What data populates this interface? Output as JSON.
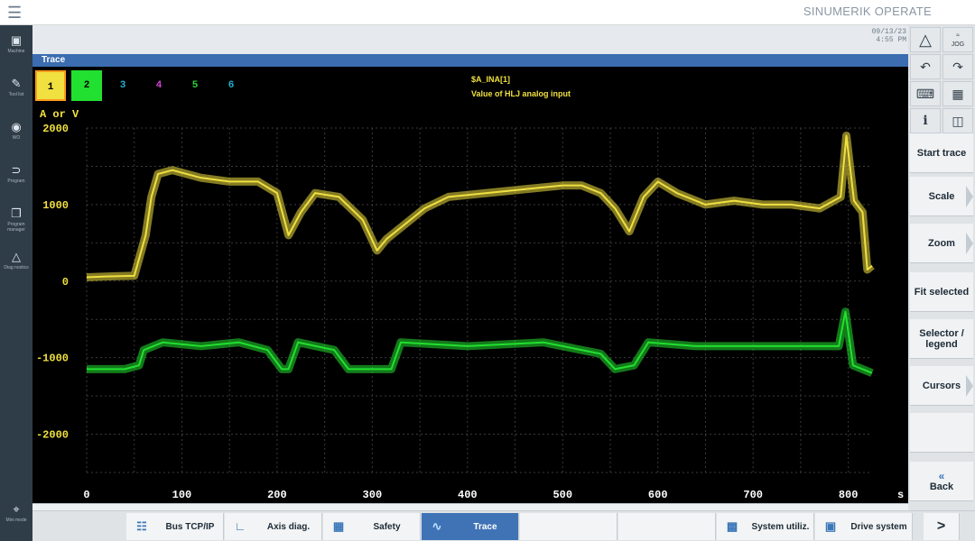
{
  "topbar": {
    "brand": "SINUMERIK OPERATE",
    "menu_icon": "hamburger-icon"
  },
  "leftnav": [
    {
      "label": "Machine",
      "icon": "machine-icon"
    },
    {
      "label": "Tool list",
      "icon": "tool-list-icon"
    },
    {
      "label": "WO",
      "icon": "work-offset-icon"
    },
    {
      "label": "Program",
      "icon": "program-icon"
    },
    {
      "label": "Program manager",
      "icon": "program-manager-icon"
    },
    {
      "label": "Diag nostics",
      "icon": "diagnostics-icon"
    },
    {
      "label": "Mini mode",
      "icon": "minimode-icon"
    }
  ],
  "status": {
    "date": "09/13/23",
    "time": "4:55 PM"
  },
  "window": {
    "title": "Trace"
  },
  "channels": [
    {
      "label": "1",
      "color": "#f0e040",
      "selected": true
    },
    {
      "label": "2",
      "color": "#22e030",
      "selected": true
    },
    {
      "label": "3",
      "color": "#20b0d0",
      "selected": false
    },
    {
      "label": "4",
      "color": "#d040d0",
      "selected": false
    },
    {
      "label": "5",
      "color": "#30d040",
      "selected": false
    },
    {
      "label": "6",
      "color": "#20b0d0",
      "selected": false
    }
  ],
  "signal": {
    "name": "$A_INA[1]",
    "description": "Value of HLJ analog input"
  },
  "chart_data": {
    "type": "line",
    "ylabel": "A or V",
    "xlabel": "s",
    "xlim": [
      0,
      825
    ],
    "ylim": [
      -2500,
      2000
    ],
    "x_ticks": [
      0,
      100,
      200,
      300,
      400,
      500,
      600,
      700,
      800
    ],
    "y_ticks": [
      2000,
      1000,
      0,
      -1000,
      -2000
    ],
    "grid": true,
    "series": [
      {
        "color": "#f0e040",
        "x": [
          0,
          20,
          50,
          62,
          68,
          75,
          90,
          120,
          150,
          180,
          200,
          212,
          225,
          240,
          265,
          290,
          305,
          315,
          330,
          355,
          380,
          420,
          460,
          500,
          520,
          540,
          555,
          570,
          585,
          600,
          620,
          650,
          680,
          710,
          740,
          770,
          792,
          798,
          806,
          815,
          820,
          825
        ],
        "y": [
          50,
          60,
          70,
          600,
          1100,
          1400,
          1450,
          1350,
          1300,
          1300,
          1150,
          600,
          900,
          1150,
          1100,
          800,
          400,
          550,
          700,
          950,
          1100,
          1150,
          1200,
          1250,
          1250,
          1150,
          950,
          650,
          1100,
          1300,
          1150,
          1000,
          1050,
          1000,
          1000,
          950,
          1100,
          1900,
          1050,
          900,
          150,
          200
        ]
      },
      {
        "color": "#22e030",
        "x": [
          0,
          40,
          55,
          60,
          80,
          120,
          160,
          190,
          205,
          212,
          222,
          260,
          275,
          300,
          315,
          320,
          330,
          400,
          480,
          540,
          555,
          575,
          590,
          640,
          700,
          760,
          790,
          797,
          805,
          815,
          825
        ],
        "y": [
          -1150,
          -1150,
          -1100,
          -900,
          -800,
          -850,
          -800,
          -900,
          -1150,
          -1150,
          -800,
          -900,
          -1150,
          -1150,
          -1150,
          -1150,
          -800,
          -850,
          -800,
          -950,
          -1150,
          -1100,
          -800,
          -850,
          -850,
          -850,
          -850,
          -400,
          -1100,
          -1150,
          -1200
        ]
      }
    ]
  },
  "softkeys": [
    {
      "label": "Start trace",
      "arrow": false
    },
    {
      "label": "Scale",
      "arrow": true
    },
    {
      "label": "Zoom",
      "arrow": true
    },
    {
      "label": "Fit selected",
      "arrow": false
    },
    {
      "label": "Selector / legend",
      "arrow": false
    },
    {
      "label": "Cursors",
      "arrow": true
    },
    {
      "label": "",
      "arrow": false
    },
    {
      "label": "Back",
      "arrow": false
    }
  ],
  "top_icons": {
    "jog_label": "JOG"
  },
  "bottom_tabs": [
    {
      "label": "Bus TCP/IP",
      "icon": "bus-icon",
      "active": false
    },
    {
      "label": "Axis diag.",
      "icon": "axis-diag-icon",
      "active": false
    },
    {
      "label": "Safety",
      "icon": "safety-icon",
      "active": false
    },
    {
      "label": "Trace",
      "icon": "trace-icon",
      "active": true
    },
    {
      "label": "",
      "icon": "",
      "active": false
    },
    {
      "label": "",
      "icon": "",
      "active": false
    },
    {
      "label": "System utiliz.",
      "icon": "system-util-icon",
      "active": false
    },
    {
      "label": "Drive system",
      "icon": "drive-system-icon",
      "active": false
    },
    {
      "label": ">",
      "icon": "",
      "active": false
    }
  ]
}
